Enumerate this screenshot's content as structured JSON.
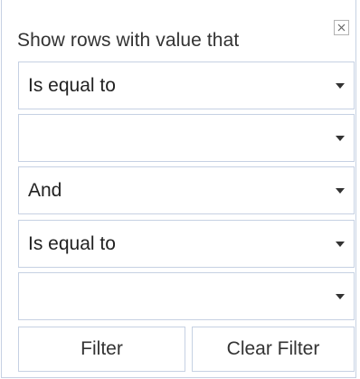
{
  "filter_panel": {
    "title": "Show rows with value that",
    "close_icon": "close-icon",
    "condition1_operator": "Is equal to",
    "condition1_value": "",
    "logical_operator": "And",
    "condition2_operator": "Is equal to",
    "condition2_value": "",
    "filter_button_label": "Filter",
    "clear_filter_button_label": "Clear Filter"
  }
}
